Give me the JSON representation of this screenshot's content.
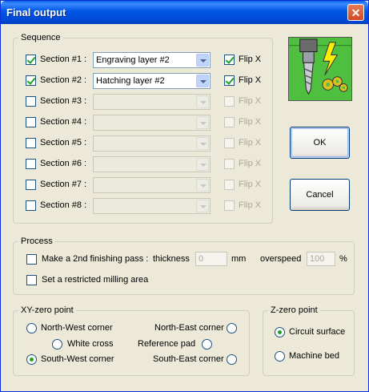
{
  "window": {
    "title": "Final output",
    "close_glyph": "✕"
  },
  "sequence": {
    "legend": "Sequence",
    "sections": [
      {
        "label": "Section #1 :",
        "checked": true,
        "layer": "Engraving layer #2",
        "enabled": true,
        "flip_label": "Flip X",
        "flip_checked": true
      },
      {
        "label": "Section #2 :",
        "checked": true,
        "layer": "Hatching layer #2",
        "enabled": true,
        "flip_label": "Flip X",
        "flip_checked": true
      },
      {
        "label": "Section #3 :",
        "checked": false,
        "layer": "",
        "enabled": false,
        "flip_label": "Flip X",
        "flip_checked": false
      },
      {
        "label": "Section #4 :",
        "checked": false,
        "layer": "",
        "enabled": false,
        "flip_label": "Flip X",
        "flip_checked": false
      },
      {
        "label": "Section #5 :",
        "checked": false,
        "layer": "",
        "enabled": false,
        "flip_label": "Flip X",
        "flip_checked": false
      },
      {
        "label": "Section #6 :",
        "checked": false,
        "layer": "",
        "enabled": false,
        "flip_label": "Flip X",
        "flip_checked": false
      },
      {
        "label": "Section #7 :",
        "checked": false,
        "layer": "",
        "enabled": false,
        "flip_label": "Flip X",
        "flip_checked": false
      },
      {
        "label": "Section #8 :",
        "checked": false,
        "layer": "",
        "enabled": false,
        "flip_label": "Flip X",
        "flip_checked": false
      }
    ]
  },
  "buttons": {
    "ok": "OK",
    "cancel": "Cancel"
  },
  "process": {
    "legend": "Process",
    "finishing_label": "Make a 2nd finishing pass :",
    "thickness_label": "thickness",
    "thickness_value": "0",
    "thickness_unit": "mm",
    "overspeed_label": "overspeed",
    "overspeed_value": "100",
    "overspeed_unit": "%",
    "restricted_label": "Set a restricted milling area"
  },
  "xy_zero": {
    "legend": "XY-zero point",
    "north_west": "North-West corner",
    "north_east": "North-East corner",
    "white_cross": "White cross",
    "reference_pad": "Reference pad",
    "south_west": "South-West corner",
    "south_east": "South-East corner",
    "selected": "south_west"
  },
  "z_zero": {
    "legend": "Z-zero point",
    "circuit_surface": "Circuit surface",
    "machine_bed": "Machine bed",
    "selected": "circuit_surface"
  },
  "icons": {
    "logo": "milling-tool-lightning-icon"
  },
  "colors": {
    "titlebar": "#0055e5",
    "dialog_bg": "#ece9d8",
    "check_mark": "#21a121",
    "logo_bg": "#4fbf40"
  }
}
